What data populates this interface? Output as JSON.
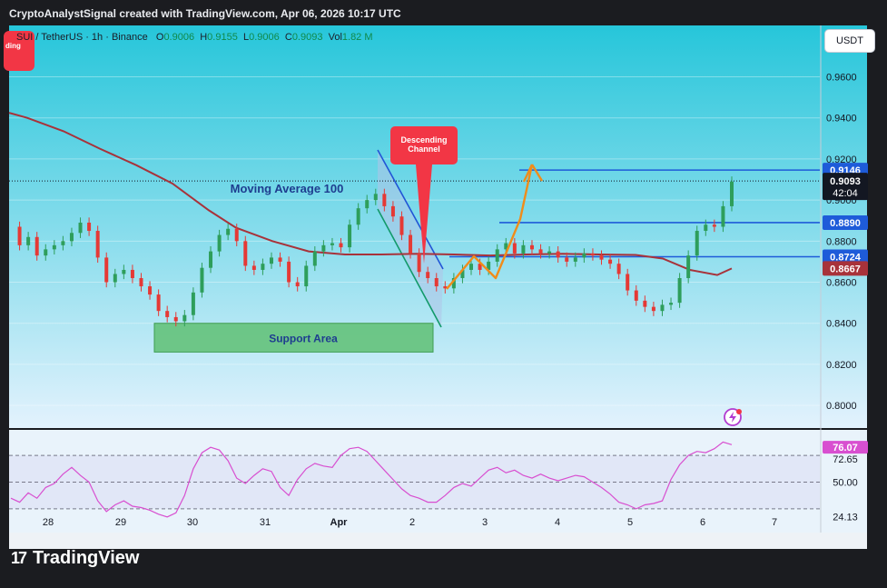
{
  "header": {
    "attribution": "CryptoAnalystSignal created with TradingView.com, Apr 06, 2026 10:17 UTC"
  },
  "symbol_bar": {
    "symbol": "SUI / TetherUS · 1h · Binance",
    "open_label": "O",
    "open": "0.9006",
    "high_label": "H",
    "high": "0.9155",
    "low_label": "L",
    "low": "0.9006",
    "close_label": "C",
    "close": "0.9093",
    "vol_label": "Vol",
    "vol": "1.82 M"
  },
  "trend_tag_text": "ding",
  "unit_button": "USDT",
  "annotations": {
    "moving_average": "Moving Average 100",
    "support": "Support Area",
    "descending_channel_line1": "Descending",
    "descending_channel_line2": "Channel"
  },
  "price_labels": {
    "resistance_top": "0.9146",
    "current_price": "0.9093",
    "countdown": "42:04",
    "level_mid": "0.8890",
    "level_low": "0.8724",
    "ma_value": "0.8667"
  },
  "rsi_labels": {
    "value": "76.07",
    "ma": "72.65",
    "mid": "50.00",
    "low": "24.13"
  },
  "footer": {
    "logo_mark": "17",
    "logo_text": "TradingView"
  },
  "colors": {
    "plot_bg_top": "#26c6da",
    "plot_bg_bottom": "#e3f2fd",
    "up": "#2e9e5b",
    "down": "#e53935",
    "ma": "#a8323a",
    "level": "#1e5bd9",
    "arrow": "#f08c1a",
    "support": "#5fbf73",
    "rsi_line": "#d84fd0"
  },
  "chart_data": {
    "type": "candlestick",
    "pair": "SUI / TetherUS",
    "timeframe": "1h",
    "exchange": "Binance",
    "x_ticks": [
      "28",
      "29",
      "30",
      "31",
      "Apr",
      "2",
      "3",
      "4",
      "5",
      "6",
      "7"
    ],
    "y_ticks": [
      "0.9600",
      "0.9400",
      "0.9200",
      "0.9000",
      "0.8800",
      "0.8600",
      "0.8400",
      "0.8200",
      "0.8000"
    ],
    "ylim": [
      0.789,
      0.985
    ],
    "horizontal_levels": [
      0.9146,
      0.889,
      0.8724
    ],
    "ma100_last": 0.8667,
    "support_zone": [
      0.826,
      0.84
    ],
    "price_path": [
      [
        0,
        0.887
      ],
      [
        1,
        0.878
      ],
      [
        2,
        0.882
      ],
      [
        3,
        0.873
      ],
      [
        4,
        0.876
      ],
      [
        5,
        0.878
      ],
      [
        6,
        0.88
      ],
      [
        7,
        0.884
      ],
      [
        8,
        0.889
      ],
      [
        9,
        0.885
      ],
      [
        10,
        0.872
      ],
      [
        11,
        0.86
      ],
      [
        12,
        0.864
      ],
      [
        13,
        0.866
      ],
      [
        14,
        0.862
      ],
      [
        15,
        0.858
      ],
      [
        16,
        0.854
      ],
      [
        17,
        0.846
      ],
      [
        18,
        0.843
      ],
      [
        19,
        0.841
      ],
      [
        20,
        0.844
      ],
      [
        21,
        0.855
      ],
      [
        22,
        0.867
      ],
      [
        23,
        0.875
      ],
      [
        24,
        0.883
      ],
      [
        25,
        0.886
      ],
      [
        26,
        0.88
      ],
      [
        27,
        0.868
      ],
      [
        28,
        0.866
      ],
      [
        29,
        0.869
      ],
      [
        30,
        0.872
      ],
      [
        31,
        0.87
      ],
      [
        32,
        0.86
      ],
      [
        33,
        0.858
      ],
      [
        34,
        0.868
      ],
      [
        35,
        0.875
      ],
      [
        36,
        0.878
      ],
      [
        37,
        0.879
      ],
      [
        38,
        0.877
      ],
      [
        39,
        0.888
      ],
      [
        40,
        0.896
      ],
      [
        41,
        0.9
      ],
      [
        42,
        0.903
      ],
      [
        43,
        0.897
      ],
      [
        44,
        0.892
      ],
      [
        45,
        0.883
      ],
      [
        46,
        0.874
      ],
      [
        47,
        0.865
      ],
      [
        48,
        0.862
      ],
      [
        49,
        0.858
      ],
      [
        50,
        0.857
      ],
      [
        51,
        0.862
      ],
      [
        52,
        0.866
      ],
      [
        53,
        0.869
      ],
      [
        54,
        0.866
      ],
      [
        55,
        0.87
      ],
      [
        56,
        0.876
      ],
      [
        57,
        0.879
      ],
      [
        58,
        0.874
      ],
      [
        59,
        0.878
      ],
      [
        60,
        0.876
      ],
      [
        61,
        0.874
      ],
      [
        62,
        0.875
      ],
      [
        63,
        0.872
      ],
      [
        64,
        0.87
      ],
      [
        65,
        0.872
      ],
      [
        66,
        0.874
      ],
      [
        67,
        0.873
      ],
      [
        68,
        0.871
      ],
      [
        69,
        0.869
      ],
      [
        70,
        0.864
      ],
      [
        71,
        0.856
      ],
      [
        72,
        0.851
      ],
      [
        73,
        0.848
      ],
      [
        74,
        0.846
      ],
      [
        75,
        0.849
      ],
      [
        76,
        0.85
      ],
      [
        77,
        0.862
      ],
      [
        78,
        0.873
      ],
      [
        79,
        0.885
      ],
      [
        80,
        0.888
      ],
      [
        81,
        0.887
      ],
      [
        82,
        0.897
      ],
      [
        83,
        0.909
      ]
    ],
    "rsi": {
      "ylim": [
        15,
        85
      ],
      "levels": [
        70,
        50,
        30
      ],
      "last": 76.07,
      "ma_last": 72.65,
      "values": [
        38,
        35,
        42,
        38,
        46,
        49,
        56,
        61,
        55,
        50,
        36,
        28,
        33,
        36,
        32,
        31,
        29,
        26,
        24,
        27,
        40,
        60,
        72,
        76,
        74,
        66,
        53,
        49,
        55,
        60,
        58,
        46,
        40,
        52,
        60,
        64,
        62,
        61,
        70,
        75,
        76,
        73,
        66,
        59,
        52,
        45,
        40,
        38,
        35,
        35,
        40,
        46,
        49,
        47,
        53,
        59,
        61,
        57,
        59,
        55,
        53,
        56,
        53,
        51,
        53,
        55,
        54,
        50,
        46,
        41,
        35,
        33,
        30,
        33,
        34,
        36,
        52,
        63,
        70,
        73,
        72,
        75,
        80,
        78
      ]
    }
  }
}
